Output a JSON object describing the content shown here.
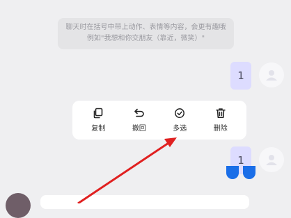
{
  "hint": {
    "line1": "聊天时在括号中带上动作、表情等内容，会更有趣哦",
    "line2": "例如\"我想和你交朋友（靠近，微笑）\""
  },
  "messages": [
    {
      "text": "1"
    },
    {
      "text": "1"
    }
  ],
  "context_menu": {
    "items": [
      {
        "label": "复制",
        "icon": "copy-icon"
      },
      {
        "label": "撤回",
        "icon": "undo-icon"
      },
      {
        "label": "多选",
        "icon": "check-circle-icon"
      },
      {
        "label": "删除",
        "icon": "trash-icon"
      }
    ]
  },
  "colors": {
    "background": "#efeff1",
    "bubble": "#dddcff",
    "annotation_arrow": "#e02020",
    "drop_marker": "#1a6ee8"
  }
}
